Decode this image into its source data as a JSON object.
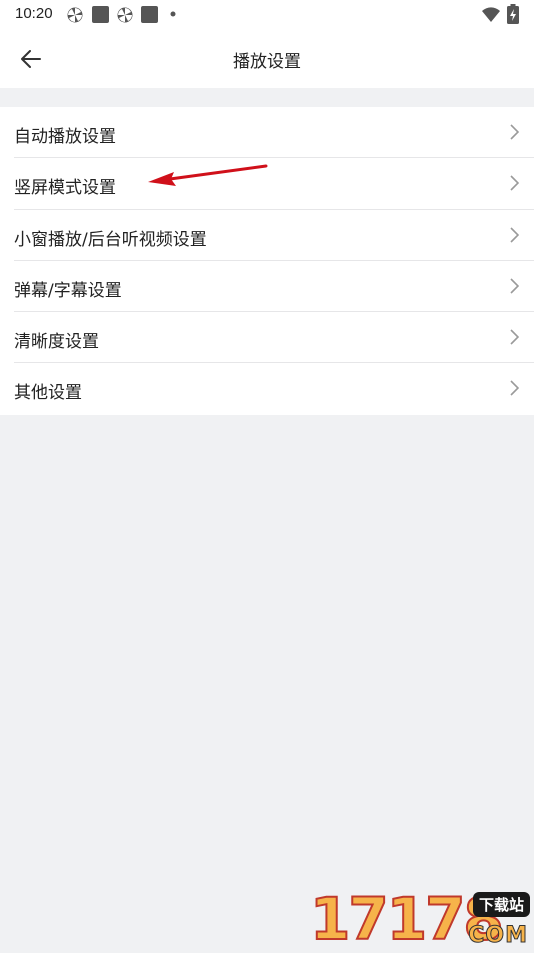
{
  "status_bar": {
    "time": "10:20",
    "icons": [
      "pinwheel-icon",
      "square-icon",
      "pinwheel-icon",
      "square-icon",
      "dot-icon",
      "wifi-icon",
      "battery-charging-icon"
    ]
  },
  "header": {
    "title": "播放设置",
    "back_icon": "arrow-left-icon"
  },
  "settings": {
    "items": [
      {
        "label": "自动播放设置"
      },
      {
        "label": "竖屏模式设置"
      },
      {
        "label": "小窗播放/后台听视频设置"
      },
      {
        "label": "弹幕/字幕设置"
      },
      {
        "label": "清晰度设置"
      },
      {
        "label": "其他设置"
      }
    ]
  },
  "watermark": {
    "number": "17178",
    "badge": "下载站",
    "domain": "COM"
  },
  "colors": {
    "background": "#f0f1f3",
    "surface": "#ffffff",
    "text": "#222222",
    "chevron": "#9a9a9a",
    "annotation": "#d0101a"
  }
}
